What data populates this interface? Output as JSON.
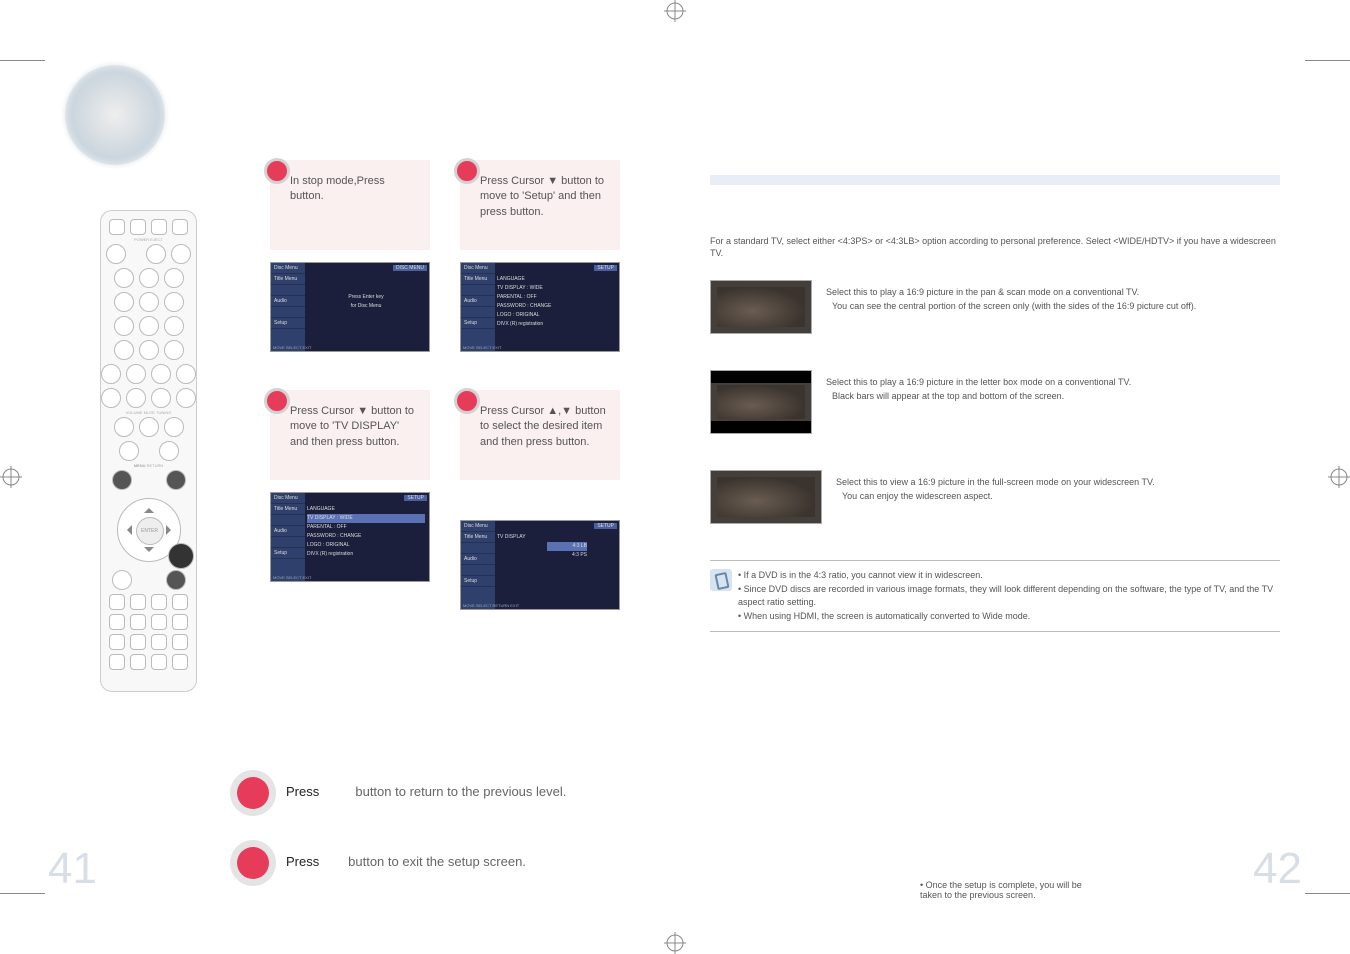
{
  "page_numbers": {
    "left": "41",
    "right": "42"
  },
  "steps": {
    "s1": "In stop mode,Press button.",
    "s2": "Press Cursor ▼ button to move to 'Setup' and then press button.",
    "s3": "Press Cursor ▼ button to move to 'TV DISPLAY' and then press button.",
    "s4": "Press Cursor ▲,▼ button to select the desired item and then press button."
  },
  "note_below_s4": "• Once the setup is complete, you will be taken to the previous screen.",
  "osd": {
    "s1": {
      "header": "DISC MENU",
      "center1": "Press Enter key",
      "center2": "for Disc Menu",
      "footer": "MOVE    SELECT    EXIT",
      "side": [
        "Disc Menu",
        "Title Menu",
        "",
        "Audio",
        "",
        "Setup"
      ]
    },
    "s2": {
      "header": "SETUP",
      "rows": [
        "LANGUAGE",
        "TV DISPLAY   : WIDE",
        "PARENTAL   : OFF",
        "PASSWORD   : CHANGE",
        "LOGO   : ORIGINAL",
        "DIVX (R) registration"
      ],
      "footer": "MOVE    SELECT    EXIT",
      "side": [
        "Disc Menu",
        "Title Menu",
        "",
        "Audio",
        "",
        "Setup"
      ]
    },
    "s3": {
      "header": "SETUP",
      "rows": [
        "LANGUAGE",
        "TV DISPLAY   : WIDE",
        "PARENTAL   : OFF",
        "PASSWORD   : CHANGE",
        "LOGO   : ORIGINAL",
        "DIVX (R) registration"
      ],
      "footer": "MOVE    SELECT    EXIT",
      "side": [
        "Disc Menu",
        "Title Menu",
        "",
        "Audio",
        "",
        "Setup"
      ]
    },
    "s4": {
      "header": "SETUP",
      "rows": [
        "TV DISPLAY",
        "4:3 LB",
        "4:3 PS"
      ],
      "footer": "MOVE    SELECT    RETURN    EXIT",
      "side": [
        "Disc Menu",
        "Title Menu",
        "",
        "Audio",
        "",
        "Setup"
      ]
    }
  },
  "right": {
    "intro": "For a standard TV, select either <4:3PS> or <4:3LB> option according to personal preference. Select <WIDE/HDTV> if you have a widescreen TV.",
    "a1_l1": "Select this to play a 16:9 picture in the pan & scan mode on a conventional TV.",
    "a1_l2": "You can see the central portion of the screen only (with the sides of the 16:9 picture cut off).",
    "a2_l1": "Select this to play a 16:9 picture in the letter box mode on a conventional TV.",
    "a2_l2": "Black bars will appear at the top and bottom of the screen.",
    "a3_l1": "Select this to view a 16:9 picture in the full-screen mode on your widescreen TV.",
    "a3_l2": "You can enjoy the widescreen aspect.",
    "info1": "• If a DVD is in the 4:3 ratio, you cannot view it in widescreen.",
    "info2": "• Since DVD discs are recorded in various image formats, they will look different depending on the software, the type of TV, and the TV aspect ratio setting.",
    "info3": "• When using HDMI, the screen is automatically converted to Wide mode."
  },
  "bottom": {
    "r1_pre": "Press",
    "r1_post": "button to return to the previous level.",
    "r2_pre": "Press",
    "r2_post": "button to exit the setup screen."
  }
}
